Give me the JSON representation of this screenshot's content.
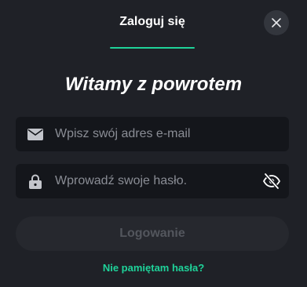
{
  "header": {
    "tab_label": "Zaloguj się",
    "accent_color": "#1fd39a"
  },
  "close": {
    "icon": "close-icon"
  },
  "heading": "Witamy z powrotem",
  "form": {
    "email": {
      "icon": "envelope-icon",
      "value": "",
      "placeholder": "Wpisz swój adres e-mail"
    },
    "password": {
      "icon": "lock-icon",
      "value": "",
      "placeholder": "Wprowadź swoje hasło.",
      "toggle_icon": "eye-off-icon"
    },
    "submit_label": "Logowanie",
    "forgot_label": "Nie pamiętam hasła?"
  }
}
